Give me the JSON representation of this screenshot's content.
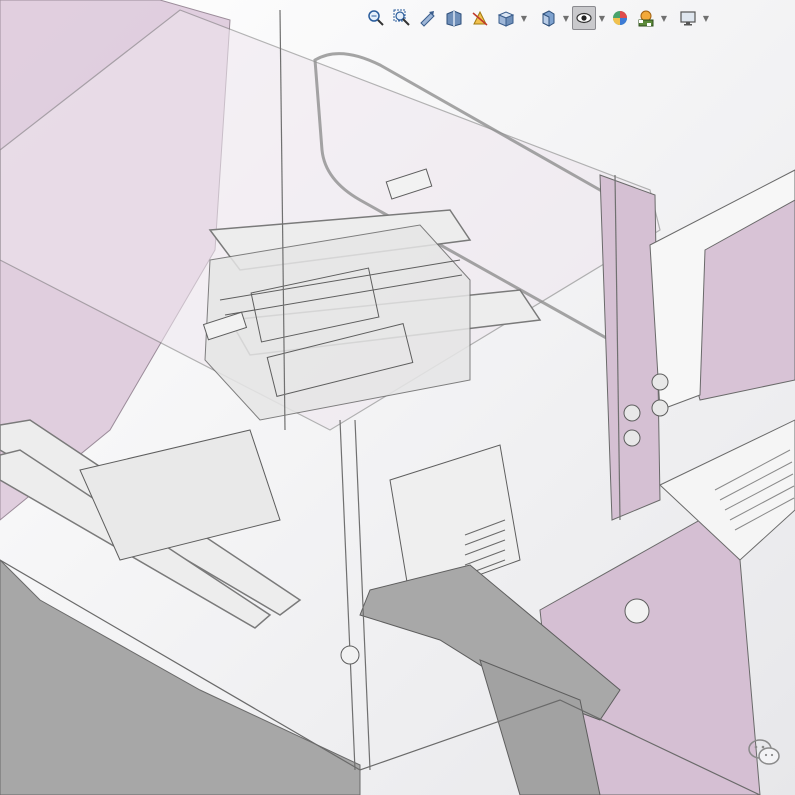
{
  "app": {
    "view": "3d-model-viewport",
    "display_mode": "transparent-assembly"
  },
  "toolbar": {
    "items": [
      {
        "icon": "zoom-to-fit-icon",
        "kind": "button"
      },
      {
        "icon": "zoom-to-area-icon",
        "kind": "button"
      },
      {
        "icon": "previous-view-icon",
        "kind": "button"
      },
      {
        "icon": "section-view-icon",
        "kind": "button"
      },
      {
        "icon": "dynamic-annotation-icon",
        "kind": "button"
      },
      {
        "icon": "view-orientation-icon",
        "kind": "dropdown"
      },
      {
        "icon": "display-style-icon",
        "kind": "dropdown"
      },
      {
        "icon": "hide-show-items-icon",
        "kind": "dropdown",
        "active": true
      },
      {
        "icon": "edit-appearance-icon",
        "kind": "button"
      },
      {
        "icon": "apply-scene-icon",
        "kind": "dropdown"
      },
      {
        "icon": "view-settings-icon",
        "kind": "dropdown"
      }
    ]
  },
  "colors": {
    "panel_lilac": "#d8c3d6",
    "panel_lilac_light": "#e6d6e4",
    "frame_white": "#f4f4f4",
    "frame_gray": "#b9b9b9",
    "floor_gray": "#9f9f9f",
    "background": "#f3f3f5",
    "edge_line": "#6a6a6a"
  }
}
